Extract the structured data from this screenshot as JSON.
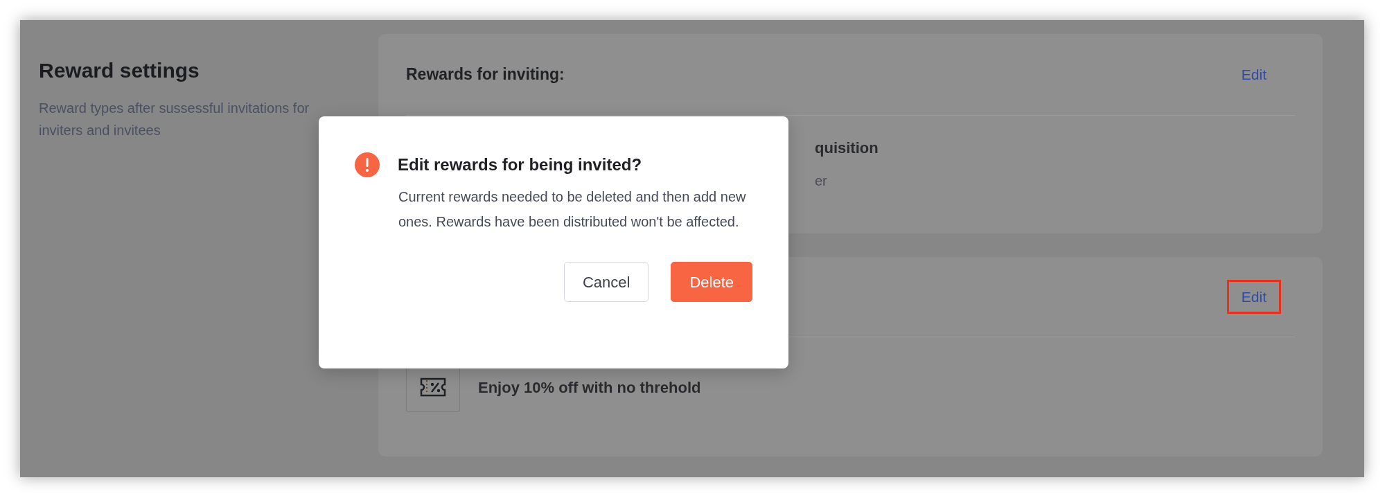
{
  "section": {
    "title": "Reward settings",
    "description": "Reward types after sussessful invitations for inviters and invitees"
  },
  "cards": [
    {
      "title": "Rewards for inviting:",
      "edit": "Edit",
      "highlighted": false,
      "lines": [
        "quisition",
        "er"
      ]
    },
    {
      "edit": "Edit",
      "highlighted": true,
      "reward": {
        "text": "Enjoy 10% off with no threhold"
      }
    }
  ],
  "dialog": {
    "title": "Edit rewards for being invited?",
    "message": "Current rewards needed to be deleted and then add new ones. Rewards have been distributed won't be affected.",
    "buttons": [
      {
        "label": "Cancel",
        "kind": "secondary"
      },
      {
        "label": "Delete",
        "kind": "danger"
      }
    ]
  }
}
